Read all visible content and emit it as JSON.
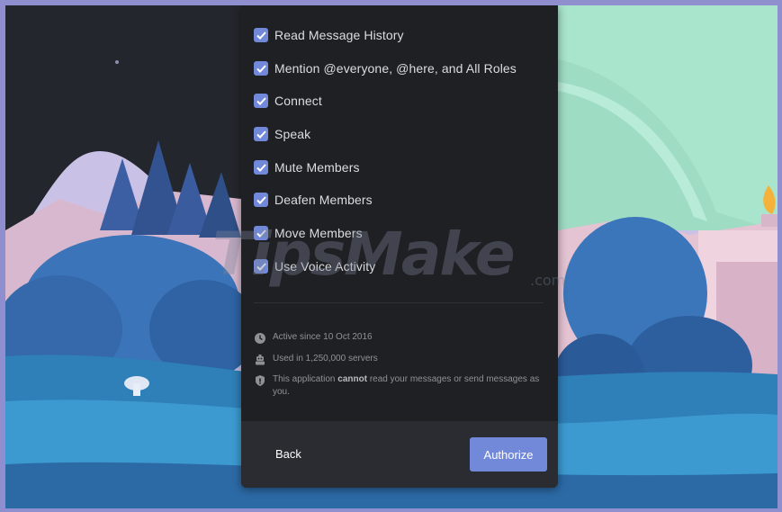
{
  "permissions": [
    {
      "label": "Read Message History",
      "checked": true
    },
    {
      "label": "Mention @everyone, @here, and All Roles",
      "checked": true
    },
    {
      "label": "Connect",
      "checked": true
    },
    {
      "label": "Speak",
      "checked": true
    },
    {
      "label": "Mute Members",
      "checked": true
    },
    {
      "label": "Deafen Members",
      "checked": true
    },
    {
      "label": "Move Members",
      "checked": true
    },
    {
      "label": "Use Voice Activity",
      "checked": true
    }
  ],
  "info": {
    "active_since": "Active since 10 Oct 2016",
    "used_in": "Used in 1,250,000 servers",
    "notice_prefix": "This application ",
    "notice_emphasis": "cannot",
    "notice_suffix": " read your messages or send messages as you."
  },
  "footer": {
    "back_label": "Back",
    "authorize_label": "Authorize"
  },
  "watermark": {
    "text": "TipsMake",
    "suffix": ".com"
  },
  "colors": {
    "accent": "#7289da",
    "modal_bg": "#1f2023",
    "footer_bg": "#2a2c31",
    "frame": "#8f8fd0"
  },
  "icons": {
    "checkbox": "check-icon",
    "clock": "clock-icon",
    "servers": "robot-icon",
    "shield": "shield-icon"
  }
}
